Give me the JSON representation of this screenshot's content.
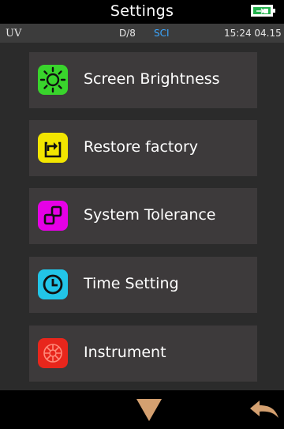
{
  "header": {
    "title": "Settings",
    "battery_icon": "battery-charging-icon"
  },
  "status": {
    "light_source": "UV",
    "geometry": "D/8",
    "mode": "SCI",
    "time": "15:24 04.15"
  },
  "menu": {
    "items": [
      {
        "label": "Screen Brightness",
        "icon": "brightness-icon",
        "color": "#39d42c"
      },
      {
        "label": "Restore factory",
        "icon": "restore-icon",
        "color": "#f2e500"
      },
      {
        "label": "System Tolerance",
        "icon": "tolerance-icon",
        "color": "#e600e6"
      },
      {
        "label": "Time Setting",
        "icon": "clock-icon",
        "color": "#22c5e8"
      },
      {
        "label": "Instrument",
        "icon": "instrument-icon",
        "color": "#e8261c"
      }
    ]
  },
  "footer": {
    "down_icon": "down-arrow-icon",
    "back_icon": "back-arrow-icon",
    "down_color": "#d4a070",
    "back_color": "#d4a070"
  }
}
